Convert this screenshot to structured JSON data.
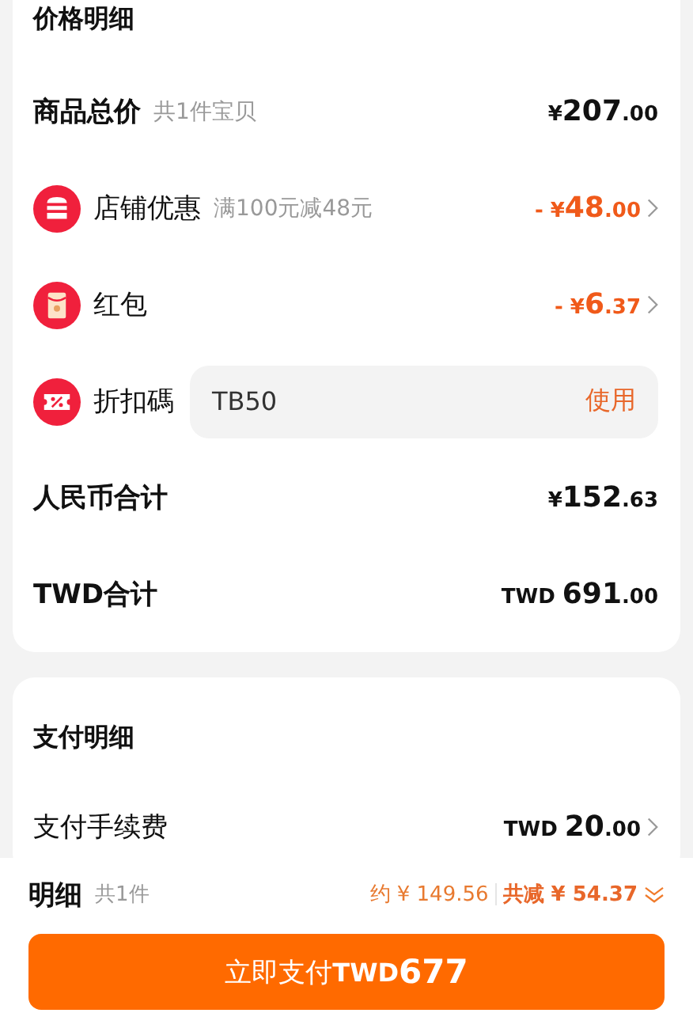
{
  "price_card": {
    "title": "价格明细",
    "rows": [
      {
        "kind": "total",
        "label": "商品总价",
        "note": "共1件宝贝",
        "amount": {
          "currency": "¥",
          "integer": "207",
          "fraction": ".00"
        }
      },
      {
        "kind": "shop_discount",
        "label": "店铺优惠",
        "note": "满100元减48元",
        "amount": {
          "sign": "- ",
          "currency": "¥",
          "integer": "48",
          "fraction": ".00"
        }
      },
      {
        "kind": "red_packet",
        "label": "红包",
        "amount": {
          "sign": "- ",
          "currency": "¥",
          "integer": "6",
          "fraction": ".37"
        }
      },
      {
        "kind": "code",
        "label": "折扣碼",
        "value": "TB50",
        "action": "使用"
      },
      {
        "kind": "total",
        "label": "人民币合计",
        "amount": {
          "currency": "¥",
          "integer": "152",
          "fraction": ".63"
        }
      },
      {
        "kind": "total",
        "label": "TWD合计",
        "amount": {
          "currency": "TWD ",
          "integer": "691",
          "fraction": ".00"
        }
      }
    ]
  },
  "payment_card": {
    "title": "支付明细",
    "rows": [
      {
        "kind": "fee",
        "label": "支付手续费",
        "amount": {
          "currency": "TWD ",
          "integer": "20",
          "fraction": ".00"
        }
      }
    ]
  },
  "footer": {
    "label": "明细",
    "count": "共1件",
    "approx": "约 ¥ 149.56",
    "saved": "共减 ¥ 54.37",
    "pay_button": {
      "label": "立即支付",
      "currency": "TWD",
      "amount": "677"
    }
  }
}
